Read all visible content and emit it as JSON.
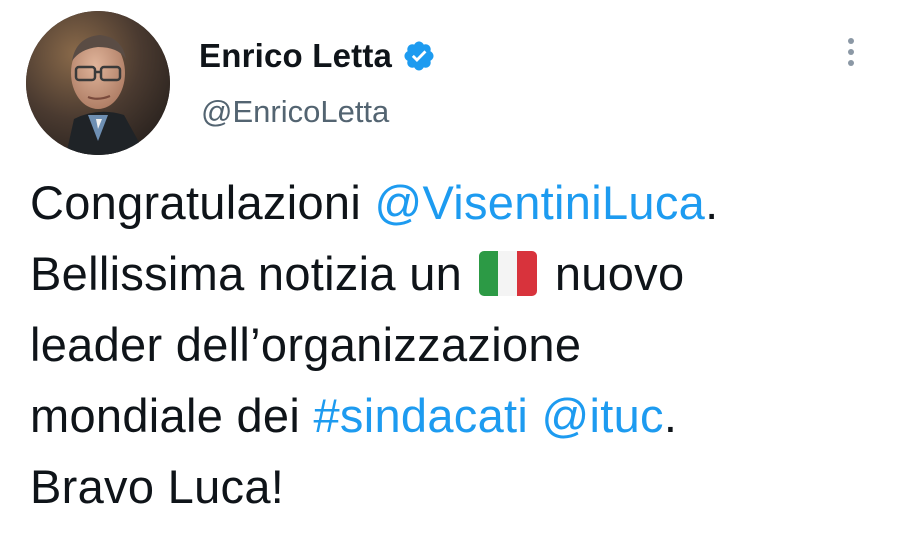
{
  "author": {
    "display_name": "Enrico Letta",
    "handle": "@EnricoLetta",
    "verified": true
  },
  "tweet": {
    "line1": {
      "text": "Congratulazioni ",
      "mention": "@VisentiniLuca",
      "suffix": "."
    },
    "line2": {
      "text_before": "Bellissima notizia un ",
      "flag_emoji": "italian-flag",
      "text_after": " nuovo"
    },
    "line3": {
      "text": "leader dell’organizzazione"
    },
    "line4": {
      "text": "mondiale dei ",
      "hashtag": "#sindacati",
      "space": " ",
      "mention": "@ituc",
      "suffix": "."
    },
    "line5": {
      "text": "Bravo Luca!"
    }
  },
  "colors": {
    "link": "#1d9bf0",
    "text": "#0f1419",
    "secondary": "#536471",
    "verified_badge": "#1d9bf0"
  },
  "icons": {
    "more": "more-vertical-icon",
    "verified": "verified-badge-icon"
  }
}
